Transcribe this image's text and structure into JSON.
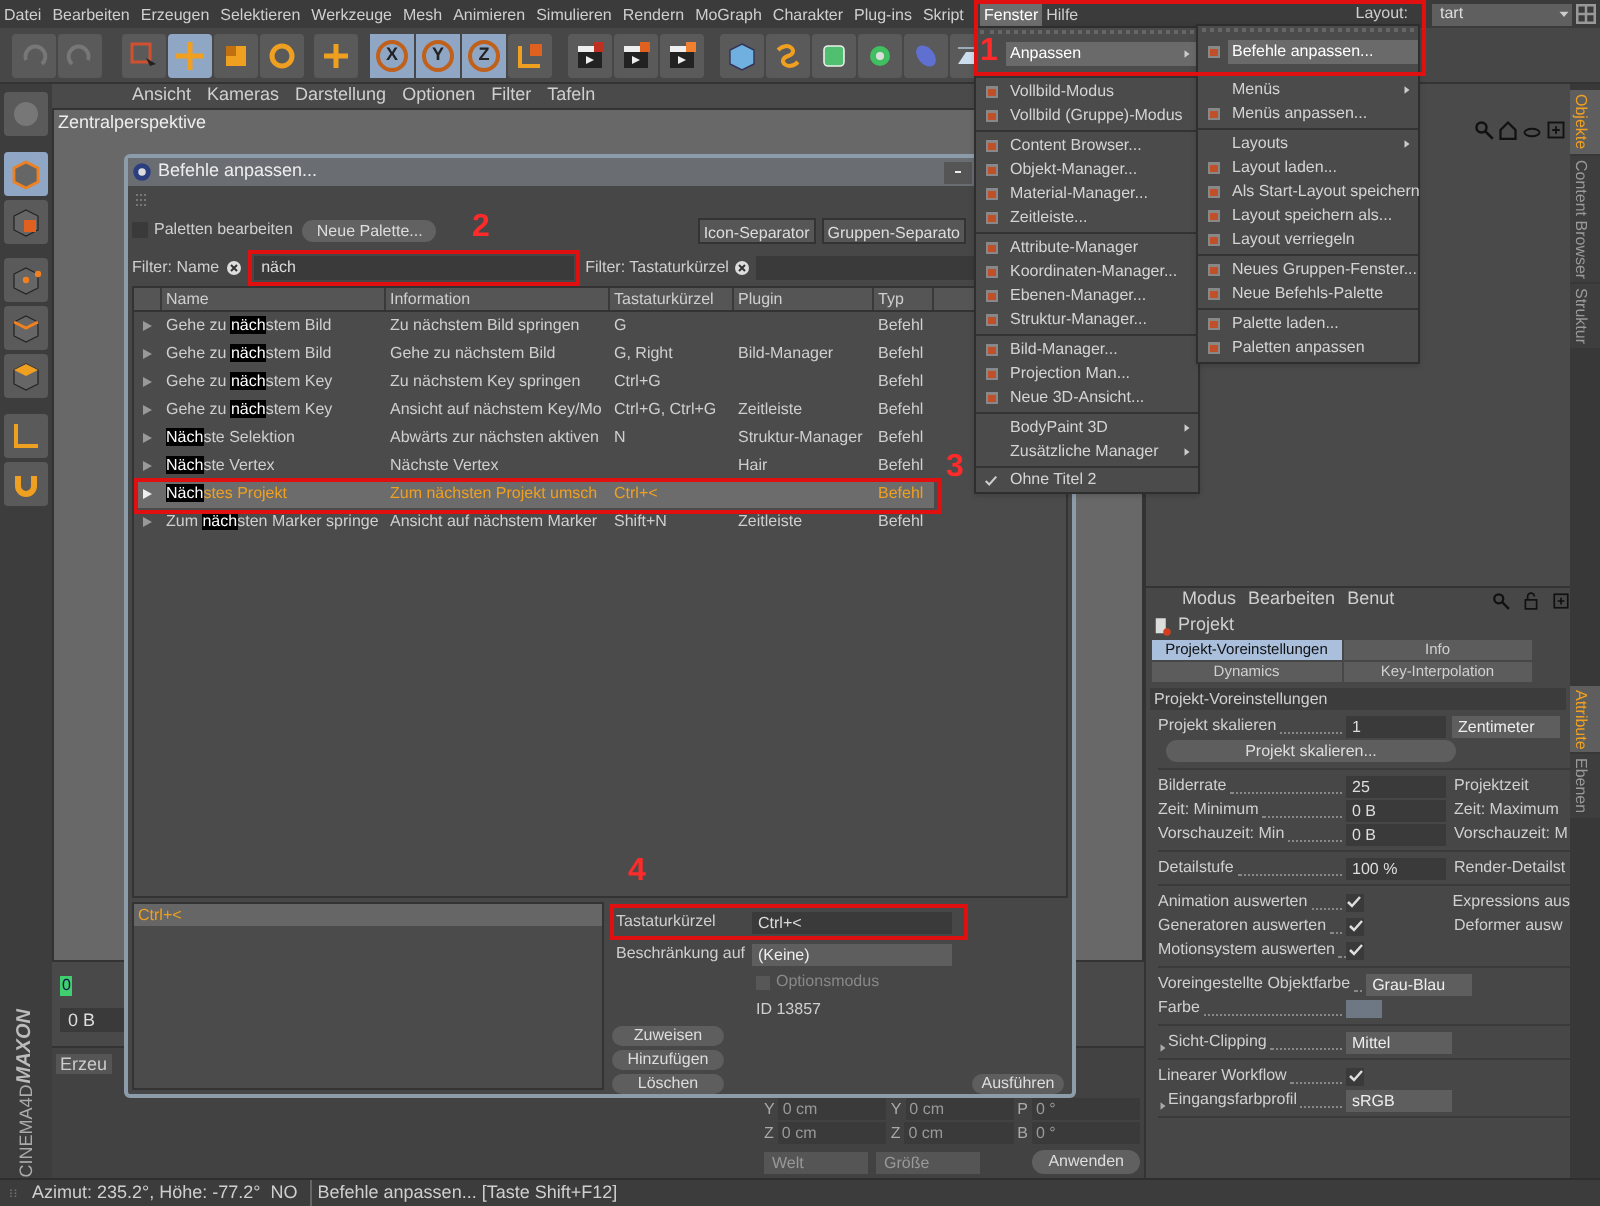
{
  "menubar": {
    "items": [
      {
        "label": "Datei",
        "selected": false
      },
      {
        "label": "Bearbeiten",
        "selected": false
      },
      {
        "label": "Erzeugen",
        "selected": false
      },
      {
        "label": "Selektieren",
        "selected": false
      },
      {
        "label": "Werkzeuge",
        "selected": false
      },
      {
        "label": "Mesh",
        "selected": false
      },
      {
        "label": "Animieren",
        "selected": false
      },
      {
        "label": "Simulieren",
        "selected": false
      },
      {
        "label": "Rendern",
        "selected": false
      },
      {
        "label": "MoGraph",
        "selected": false
      },
      {
        "label": "Charakter",
        "selected": false
      },
      {
        "label": "Plug-ins",
        "selected": false
      },
      {
        "label": "Skript",
        "selected": false
      },
      {
        "label": "Fenster",
        "selected": true
      },
      {
        "label": "Hilfe",
        "selected": false
      }
    ],
    "layout_label": "Layout:",
    "layout_value": "tart"
  },
  "toolbar": {
    "axis_buttons": [
      "X",
      "Y",
      "Z"
    ]
  },
  "viewport": {
    "menu": [
      "Ansicht",
      "Kameras",
      "Darstellung",
      "Optionen",
      "Filter",
      "Tafeln"
    ],
    "camera": "Zentralperspektive"
  },
  "timeline": {
    "frame": "0",
    "field": "0 B"
  },
  "object_panel_tab": "Erzeu",
  "coordinates": {
    "rows": [
      [
        "Y",
        "0 cm",
        "Y",
        "0 cm",
        "P",
        "0 °"
      ],
      [
        "Z",
        "0 cm",
        "Z",
        "0 cm",
        "B",
        "0 °"
      ]
    ],
    "dropdowns": [
      "Welt",
      "Größe"
    ],
    "apply": "Anwenden"
  },
  "logo": {
    "brand": "MAXON",
    "product": "CINEMA4D"
  },
  "status_bar": {
    "position": "Azimut: 235.2°, Höhe: -77.2°  NO",
    "message": "Befehle anpassen... [Taste Shift+F12]"
  },
  "right_tabs": [
    {
      "label": "Objekte",
      "selected": true
    },
    {
      "label": "Content Browser",
      "selected": false
    },
    {
      "label": "Struktur",
      "selected": false
    }
  ],
  "attribute_side_tabs": [
    {
      "label": "Attribute",
      "selected": true
    },
    {
      "label": "Ebenen",
      "selected": false
    }
  ],
  "attributes": {
    "menu": [
      "Modus",
      "Bearbeiten",
      "Benut"
    ],
    "object": "Projekt",
    "tabs": [
      {
        "label": "Projekt-Voreinstellungen",
        "selected": true
      },
      {
        "label": "Info",
        "selected": false
      },
      {
        "label": "Dynamics",
        "selected": false
      },
      {
        "label": "Key-Interpolation",
        "selected": false
      }
    ],
    "section": "Projekt-Voreinstellungen",
    "groups": [
      [
        {
          "kind": "number",
          "label": "Projekt skalieren",
          "value": "1",
          "unit": "Zentimeter"
        },
        {
          "kind": "button",
          "label": "Projekt skalieren..."
        }
      ],
      [
        {
          "kind": "number",
          "label": "Bilderrate",
          "value": "25",
          "right": "Projektzeit"
        },
        {
          "kind": "number",
          "label": "Zeit: Minimum",
          "value": "0 B",
          "right": "Zeit: Maximum"
        },
        {
          "kind": "number",
          "label": "Vorschauzeit: Min",
          "value": "0 B",
          "right": "Vorschauzeit: M"
        }
      ],
      [
        {
          "kind": "number",
          "label": "Detailstufe",
          "value": "100 %",
          "right": "Render-Detailst"
        }
      ],
      [
        {
          "kind": "check",
          "label": "Animation auswerten",
          "checked": true,
          "right": "Expressions aus"
        },
        {
          "kind": "check",
          "label": "Generatoren auswerten",
          "checked": true,
          "right": "Deformer ausw"
        },
        {
          "kind": "check",
          "label": "Motionsystem auswerten",
          "checked": true
        }
      ],
      [
        {
          "kind": "dropdown",
          "label": "Voreingestellte Objektfarbe",
          "value": "Grau-Blau"
        },
        {
          "kind": "swatch",
          "label": "Farbe"
        }
      ],
      [
        {
          "kind": "fold-dropdown",
          "label": "Sicht-Clipping",
          "value": "Mittel"
        }
      ],
      [
        {
          "kind": "check",
          "label": "Linearer Workflow",
          "checked": true
        },
        {
          "kind": "fold-dropdown",
          "label": "Eingangsfarbprofil",
          "value": "sRGB"
        }
      ]
    ]
  },
  "dialog": {
    "title": "Befehle anpassen...",
    "edit_palettes": {
      "label": "Paletten bearbeiten",
      "checked": false
    },
    "new_palette": "Neue Palette...",
    "separators": [
      "Icon-Separator",
      "Gruppen-Separato"
    ],
    "filter_name": {
      "label": "Filter: Name",
      "value": "näch"
    },
    "filter_shortcut": {
      "label": "Filter: Tastaturkürzel"
    },
    "columns": [
      "Name",
      "Information",
      "Tastaturkürzel",
      "Plugin",
      "Typ"
    ],
    "rows": [
      {
        "name": {
          "pre": "Gehe zu ",
          "hit": "näch",
          "post": "stem Bild"
        },
        "information": "Zu nächstem Bild springen",
        "shortcut": "G",
        "type": "Befehl",
        "selected": false
      },
      {
        "name": {
          "pre": "Gehe zu ",
          "hit": "näch",
          "post": "stem Bild"
        },
        "information": "Gehe zu nächstem Bild",
        "shortcut": "G, Right",
        "plugin": "Bild-Manager",
        "type": "Befehl",
        "selected": false
      },
      {
        "name": {
          "pre": "Gehe zu ",
          "hit": "näch",
          "post": "stem Key"
        },
        "information": "Zu nächstem Key springen",
        "shortcut": "Ctrl+G",
        "type": "Befehl",
        "selected": false
      },
      {
        "name": {
          "pre": "Gehe zu ",
          "hit": "näch",
          "post": "stem Key"
        },
        "information": "Ansicht auf nächstem Key/Mo",
        "shortcut": "Ctrl+G, Ctrl+G",
        "plugin": "Zeitleiste",
        "type": "Befehl",
        "selected": false
      },
      {
        "name": {
          "hit": "Näch",
          "post": "ste Selektion"
        },
        "information": "Abwärts zur nächsten aktiven",
        "shortcut": "N",
        "plugin": "Struktur-Manager",
        "type": "Befehl",
        "selected": false
      },
      {
        "name": {
          "hit": "Näch",
          "post": "ste Vertex"
        },
        "information": "Nächste Vertex",
        "plugin": "Hair",
        "type": "Befehl",
        "selected": false
      },
      {
        "name": {
          "hit": "Näch",
          "post": "stes Projekt"
        },
        "information": "Zum nächsten Projekt umsch",
        "shortcut": "Ctrl+<",
        "type": "Befehl",
        "selected": true
      },
      {
        "name": {
          "pre": "Zum ",
          "hit": "näch",
          "post": "sten Marker springe"
        },
        "information": "Ansicht auf nächstem Marker",
        "shortcut": "Shift+N",
        "plugin": "Zeitleiste",
        "type": "Befehl",
        "selected": false
      }
    ],
    "shortcuts": [
      {
        "label": "Ctrl+<",
        "selected": true
      }
    ],
    "shortcut_field": {
      "label": "Tastaturkürzel",
      "value": "Ctrl+<"
    },
    "restriction": {
      "label": "Beschränkung auf",
      "value": "(Keine)"
    },
    "options_mode": {
      "label": "Optionsmodus",
      "checked": false,
      "disabled": true
    },
    "id": "ID 13857",
    "buttons": [
      "Zuweisen",
      "Hinzufügen",
      "Löschen"
    ],
    "execute": "Ausführen"
  },
  "window_menu": {
    "groups": [
      [
        {
          "label": "Anpassen",
          "submenu": true,
          "selected": true
        }
      ],
      [
        {
          "label": "Vollbild-Modus",
          "submenu": false,
          "selected": false
        },
        {
          "label": "Vollbild (Gruppe)-Modus",
          "submenu": false,
          "selected": false
        }
      ],
      [
        {
          "label": "Content Browser...",
          "submenu": false,
          "selected": false
        },
        {
          "label": "Objekt-Manager...",
          "submenu": false,
          "selected": false
        },
        {
          "label": "Material-Manager...",
          "submenu": false,
          "selected": false
        },
        {
          "label": "Zeitleiste...",
          "submenu": false,
          "selected": false
        }
      ],
      [
        {
          "label": "Attribute-Manager",
          "submenu": false,
          "selected": false
        },
        {
          "label": "Koordinaten-Manager...",
          "submenu": false,
          "selected": false
        },
        {
          "label": "Ebenen-Manager...",
          "submenu": false,
          "selected": false
        },
        {
          "label": "Struktur-Manager...",
          "submenu": false,
          "selected": false
        }
      ],
      [
        {
          "label": "Bild-Manager...",
          "submenu": false,
          "selected": false
        },
        {
          "label": "Projection Man...",
          "submenu": false,
          "selected": false
        },
        {
          "label": "Neue 3D-Ansicht...",
          "submenu": false,
          "selected": false
        }
      ],
      [
        {
          "label": "BodyPaint 3D",
          "submenu": true,
          "selected": false
        },
        {
          "label": "Zusätzliche Manager",
          "submenu": true,
          "selected": false
        }
      ]
    ],
    "windows": [
      {
        "label": "Ohne Titel 2",
        "checked": true
      }
    ]
  },
  "customize_menu": {
    "groups": [
      [
        {
          "label": "Befehle anpassen...",
          "submenu": false,
          "selected": true
        }
      ],
      [
        {
          "label": "Menüs",
          "submenu": true,
          "selected": false
        },
        {
          "label": "Menüs anpassen...",
          "submenu": false,
          "selected": false
        }
      ],
      [
        {
          "label": "Layouts",
          "submenu": true,
          "selected": false
        },
        {
          "label": "Layout laden...",
          "submenu": false,
          "selected": false
        },
        {
          "label": "Als Start-Layout speichern",
          "submenu": false,
          "selected": false
        },
        {
          "label": "Layout speichern als...",
          "submenu": false,
          "selected": false
        },
        {
          "label": "Layout verriegeln",
          "submenu": false,
          "selected": false
        }
      ],
      [
        {
          "label": "Neues Gruppen-Fenster...",
          "submenu": false,
          "selected": false
        },
        {
          "label": "Neue Befehls-Palette",
          "submenu": false,
          "selected": false
        }
      ],
      [
        {
          "label": "Palette laden...",
          "submenu": false,
          "selected": false
        },
        {
          "label": "Paletten anpassen",
          "submenu": false,
          "selected": false
        }
      ]
    ]
  },
  "annotations": [
    "1",
    "2",
    "3",
    "4"
  ]
}
